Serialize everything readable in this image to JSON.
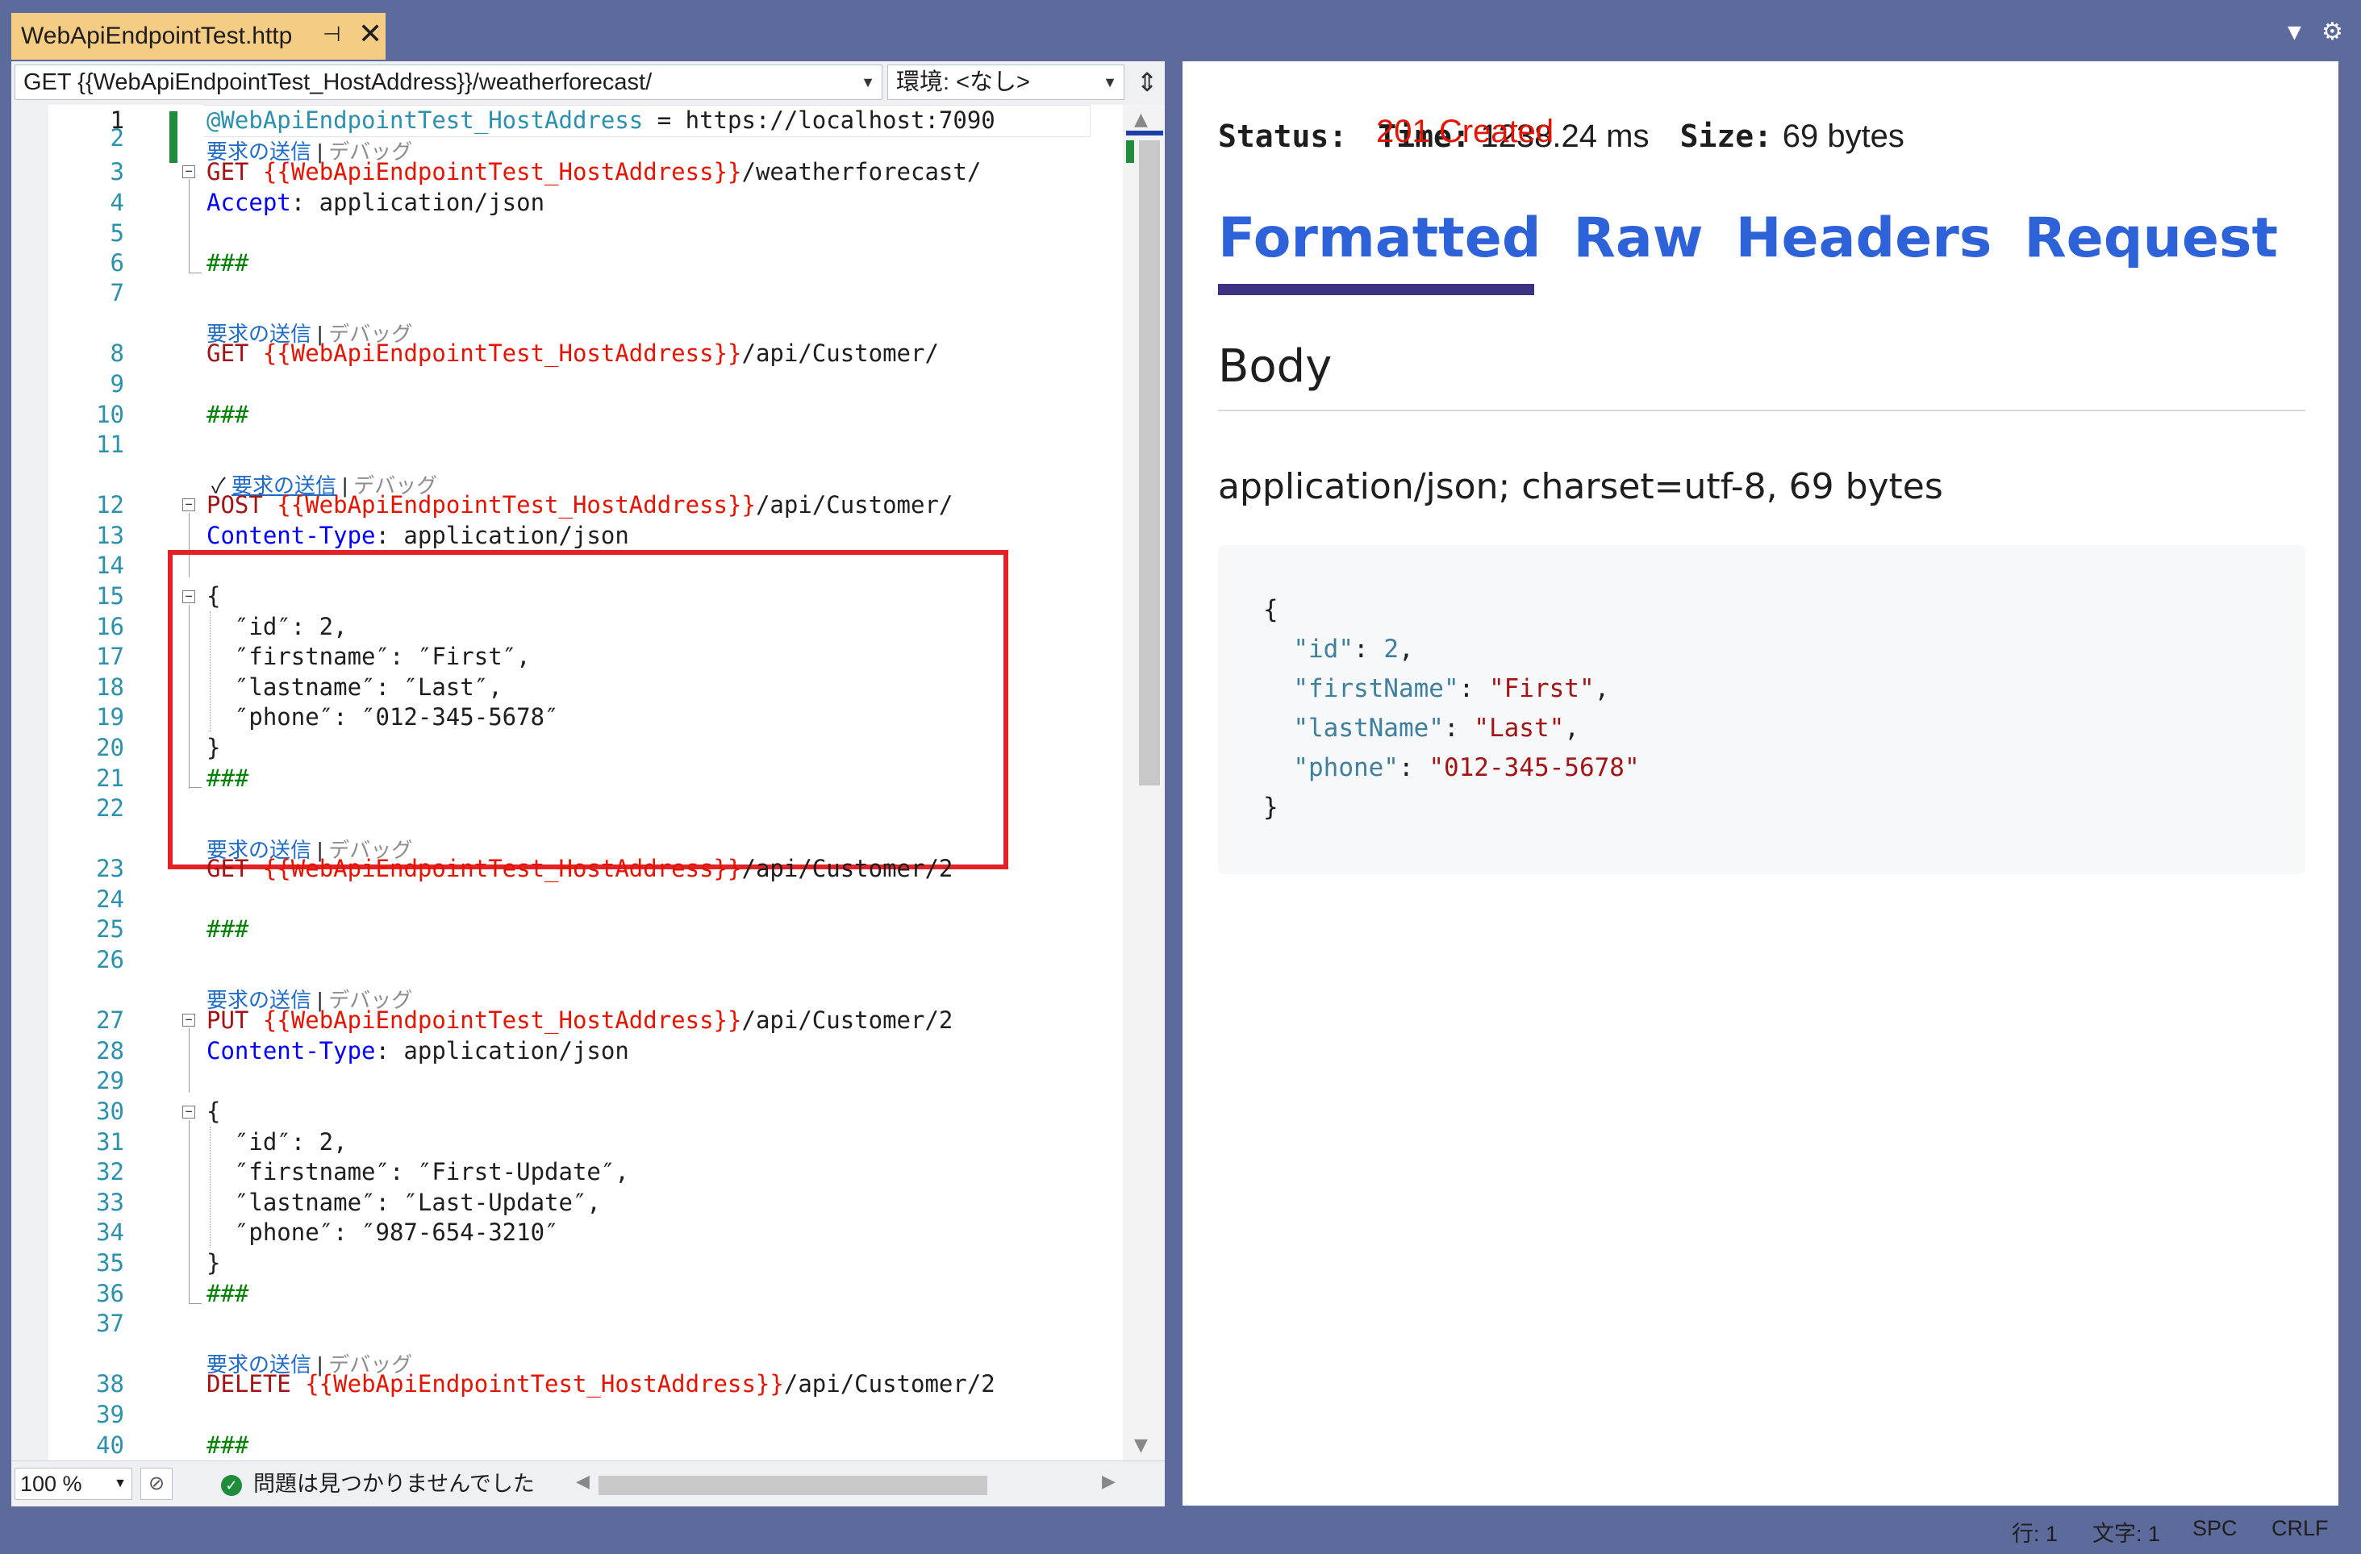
{
  "tab": {
    "title": "WebApiEndpointTest.http",
    "pin_icon": "pin-icon",
    "close_icon": "close-icon"
  },
  "nav": {
    "request_selector": "GET {{WebApiEndpointTest_HostAddress}}/weatherforecast/",
    "environment_selector": "環境: <なし>"
  },
  "codelens": {
    "send": "要求の送信",
    "separator": "|",
    "debug": "デバッグ"
  },
  "editor": {
    "line_numbers": [
      "1",
      "2",
      "3",
      "4",
      "5",
      "6",
      "7",
      "8",
      "9",
      "10",
      "11",
      "12",
      "13",
      "14",
      "15",
      "16",
      "17",
      "18",
      "19",
      "20",
      "21",
      "22",
      "23",
      "24",
      "25",
      "26",
      "27",
      "28",
      "29",
      "30",
      "31",
      "32",
      "33",
      "34",
      "35",
      "36",
      "37",
      "38",
      "39",
      "40"
    ],
    "l1": {
      "var": "@WebApiEndpointTest_HostAddress",
      "rest": " = https://localhost:7090"
    },
    "l3": {
      "method": "GET",
      "var": " {{WebApiEndpointTest_HostAddress}}",
      "path": "/weatherforecast/"
    },
    "l4": {
      "header": "Accept",
      "rest": ": application/json"
    },
    "l6": "###",
    "l8": {
      "method": "GET",
      "var": " {{WebApiEndpointTest_HostAddress}}",
      "path": "/api/Customer/"
    },
    "l10": "###",
    "l12": {
      "method": "POST",
      "var": " {{WebApiEndpointTest_HostAddress}}",
      "path": "/api/Customer/"
    },
    "l13": {
      "header": "Content-Type",
      "rest": ": application/json"
    },
    "l15": "{",
    "l16": "  ″id″: 2,",
    "l17": "  ″firstname″: ″First″,",
    "l18": "  ″lastname″: ″Last″,",
    "l19": "  ″phone″: ″012-345-5678″",
    "l20": "}",
    "l21": "###",
    "l23": {
      "method": "GET",
      "var": " {{WebApiEndpointTest_HostAddress}}",
      "path": "/api/Customer/2"
    },
    "l25": "###",
    "l27": {
      "method": "PUT",
      "var": " {{WebApiEndpointTest_HostAddress}}",
      "path": "/api/Customer/2"
    },
    "l28": {
      "header": "Content-Type",
      "rest": ": application/json"
    },
    "l30": "{",
    "l31": "  ″id″: 2,",
    "l32": "  ″firstname″: ″First-Update″,",
    "l33": "  ″lastname″: ″Last-Update″,",
    "l34": "  ″phone″: ″987-654-3210″",
    "l35": "}",
    "l36": "###",
    "l38": {
      "method": "DELETE",
      "var": " {{WebApiEndpointTest_HostAddress}}",
      "path": "/api/Customer/2"
    },
    "l40": "###"
  },
  "editor_status": {
    "zoom": "100 %",
    "issues": "問題は見つかりませんでした"
  },
  "response": {
    "status_label": "Status:",
    "status_value": "201 Created",
    "time_label": "Time:",
    "time_value": "1238.24 ms",
    "size_label": "Size:",
    "size_value": "69 bytes",
    "tabs": [
      "Formatted",
      "Raw",
      "Headers",
      "Request"
    ],
    "active_tab": "Formatted",
    "body_heading": "Body",
    "content_type": "application/json; charset=utf-8, 69 bytes",
    "json": {
      "open": "{",
      "id_key": "\"id\"",
      "id_val": "2",
      "first_key": "\"firstName\"",
      "first_val": "\"First\"",
      "last_key": "\"lastName\"",
      "last_val": "\"Last\"",
      "phone_key": "\"phone\"",
      "phone_val": "\"012-345-5678\"",
      "close": "}"
    }
  },
  "statusbar": {
    "line": "行: 1",
    "char": "文字: 1",
    "spc": "SPC",
    "eol": "CRLF"
  },
  "colors": {
    "accent_tab": "#f5cc84",
    "chrome": "#5c6b9b",
    "status_created": "#e51400",
    "highlight_box": "#e32227",
    "link_blue": "#2e62d8"
  }
}
